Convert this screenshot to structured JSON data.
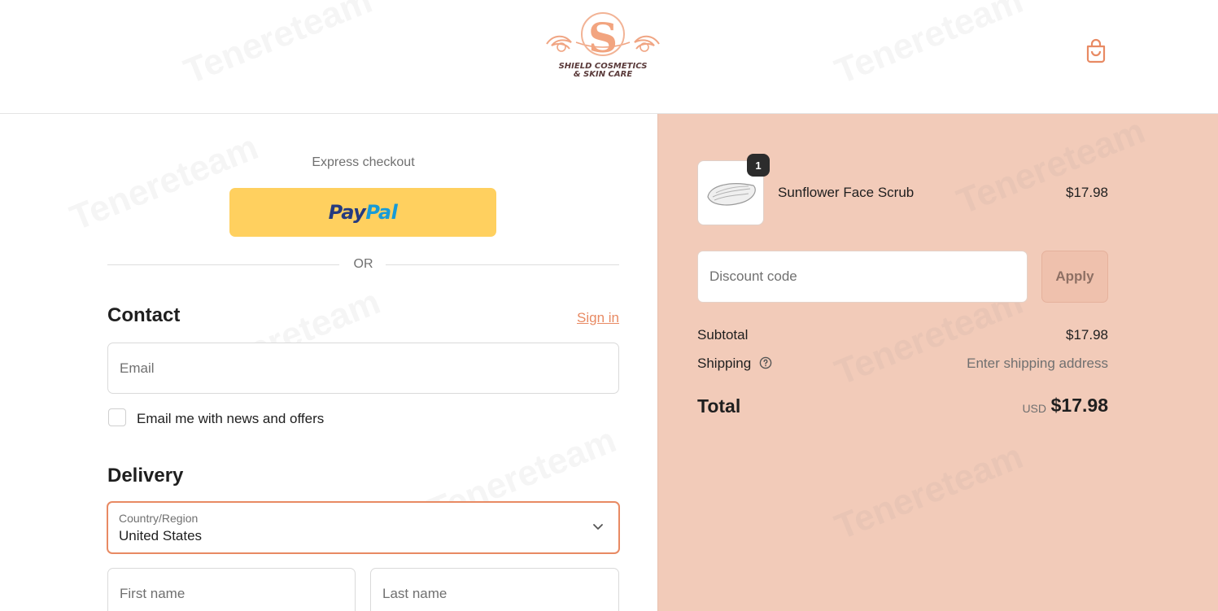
{
  "brand": {
    "line1": "SHIELD COSMETICS",
    "line2": "& SKIN CARE",
    "accent_color": "#e88a63",
    "panel_color": "#f2cbb9"
  },
  "header": {
    "cart_icon": "shopping-bag-icon"
  },
  "watermark": {
    "text": "Tenereteam"
  },
  "checkout": {
    "express_label": "Express checkout",
    "paypal": {
      "part1": "Pay",
      "part2": "Pal",
      "color": "#ffd05f"
    },
    "or_label": "OR",
    "contact": {
      "title": "Contact",
      "signin_label": "Sign in",
      "email_placeholder": "Email",
      "newsletter_label": "Email me with news and offers"
    },
    "delivery": {
      "title": "Delivery",
      "country_label": "Country/Region",
      "country_value": "United States",
      "first_name_placeholder": "First name",
      "last_name_placeholder": "Last name"
    }
  },
  "summary": {
    "item": {
      "name": "Sunflower Face Scrub",
      "price": "$17.98",
      "quantity": "1"
    },
    "discount": {
      "placeholder": "Discount code",
      "apply_label": "Apply"
    },
    "subtotal_label": "Subtotal",
    "subtotal_value": "$17.98",
    "shipping_label": "Shipping",
    "shipping_value": "Enter shipping address",
    "total_label": "Total",
    "total_currency": "USD",
    "total_value": "$17.98"
  }
}
